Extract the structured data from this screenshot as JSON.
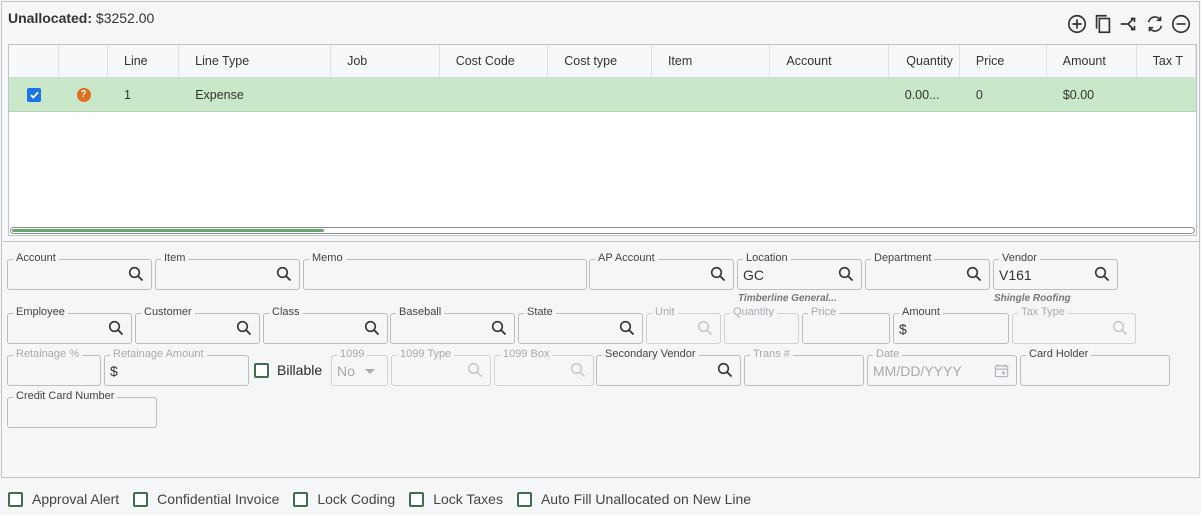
{
  "header": {
    "unallocated_label": "Unallocated:",
    "unallocated_value": "$3252.00"
  },
  "toolbar": [
    {
      "name": "add-line-icon",
      "title": "add"
    },
    {
      "name": "copy-line-icon",
      "title": "copy"
    },
    {
      "name": "split-line-icon",
      "title": "split"
    },
    {
      "name": "refresh-icon",
      "title": "refresh"
    },
    {
      "name": "remove-line-icon",
      "title": "remove"
    }
  ],
  "grid": {
    "columns": [
      "",
      "",
      "Line",
      "Line Type",
      "Job",
      "Cost Code",
      "Cost type",
      "Item",
      "Account",
      "Quantity",
      "Price",
      "Amount",
      "Tax T"
    ],
    "rows": [
      {
        "checked": true,
        "status": "?",
        "line": "1",
        "line_type": "Expense",
        "job": "",
        "cost_code": "",
        "cost_type": "",
        "item": "",
        "account": "",
        "quantity": "0.00...",
        "price": "0",
        "amount": "$0.00",
        "tax_type": ""
      }
    ]
  },
  "form": {
    "account": {
      "label": "Account",
      "value": ""
    },
    "item": {
      "label": "Item",
      "value": ""
    },
    "memo": {
      "label": "Memo",
      "value": ""
    },
    "ap_account": {
      "label": "AP Account",
      "value": ""
    },
    "location": {
      "label": "Location",
      "value": "GC",
      "sub": "Timberline General..."
    },
    "department": {
      "label": "Department",
      "value": ""
    },
    "vendor": {
      "label": "Vendor",
      "value": "V161",
      "sub": "Shingle Roofing"
    },
    "employee": {
      "label": "Employee",
      "value": ""
    },
    "customer": {
      "label": "Customer",
      "value": ""
    },
    "class": {
      "label": "Class",
      "value": ""
    },
    "baseball": {
      "label": "Baseball",
      "value": ""
    },
    "state": {
      "label": "State",
      "value": ""
    },
    "unit": {
      "label": "Unit",
      "value": ""
    },
    "quantity": {
      "label": "Quantity",
      "value": ""
    },
    "price": {
      "label": "Price",
      "value": ""
    },
    "amount": {
      "label": "Amount",
      "value": "$"
    },
    "tax_type": {
      "label": "Tax Type",
      "value": ""
    },
    "retainage_pct": {
      "label": "Retainage %",
      "value": ""
    },
    "retainage_amount": {
      "label": "Retainage Amount",
      "value": "$"
    },
    "billable": {
      "label": "Billable",
      "checked": false
    },
    "f1099": {
      "label": "1099",
      "value": "No"
    },
    "f1099_type": {
      "label": "1099 Type",
      "value": ""
    },
    "f1099_box": {
      "label": "1099 Box",
      "value": ""
    },
    "secondary_vendor": {
      "label": "Secondary Vendor",
      "value": ""
    },
    "trans_no": {
      "label": "Trans #",
      "value": ""
    },
    "date": {
      "label": "Date",
      "placeholder": "MM/DD/YYYY"
    },
    "card_holder": {
      "label": "Card Holder",
      "value": ""
    },
    "credit_card_number": {
      "label": "Credit Card Number",
      "value": ""
    }
  },
  "footer": {
    "approval_alert": "Approval Alert",
    "confidential_invoice": "Confidential Invoice",
    "lock_coding": "Lock Coding",
    "lock_taxes": "Lock Taxes",
    "auto_fill": "Auto Fill Unallocated on New Line"
  },
  "colors": {
    "row_selected": "#c9e7c9",
    "checkbox": "#1a73e8",
    "status_icon": "#e0701d",
    "accent": "#3f6e4f"
  }
}
